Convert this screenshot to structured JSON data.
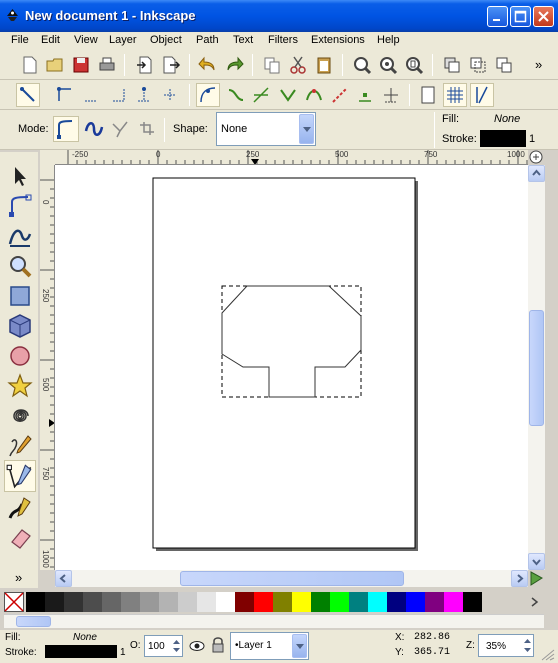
{
  "window": {
    "title": "New document 1 - Inkscape"
  },
  "menu": [
    "File",
    "Edit",
    "View",
    "Layer",
    "Object",
    "Path",
    "Text",
    "Filters",
    "Extensions",
    "Help"
  ],
  "commands_toolbar": {
    "icons": [
      "new-document-icon",
      "open-icon",
      "save-icon",
      "print-icon",
      "import-icon",
      "export-icon",
      "undo-icon",
      "redo-icon",
      "copy-icon",
      "cut-icon",
      "paste-icon",
      "zoom-selection-icon",
      "zoom-drawing-icon",
      "zoom-page-icon",
      "duplicate-icon",
      "clone-icon",
      "unlink-clone-icon"
    ],
    "overflow": "»"
  },
  "snap_toolbar": {
    "icons": [
      "snap-enable-icon",
      "snap-bbox-icon",
      "snap-bbox-edges-icon",
      "snap-bbox-corners-icon",
      "snap-bbox-midpoints-icon",
      "snap-bbox-center-icon",
      "snap-nodes-icon",
      "snap-paths-icon",
      "snap-intersections-icon",
      "snap-cusp-nodes-icon",
      "snap-smooth-nodes-icon",
      "snap-midpoints-icon",
      "snap-centers-icon",
      "snap-rotation-center-icon",
      "snap-page-border-icon",
      "snap-grid-icon",
      "snap-guide-icon"
    ]
  },
  "tool_controls": {
    "mode_label": "Mode:",
    "shape_label": "Shape:",
    "shape_value": "None",
    "fill_label": "Fill:",
    "fill_value": "None",
    "stroke_label": "Stroke:",
    "stroke_width": "1"
  },
  "rulers": {
    "h": [
      "-250",
      "0",
      "250",
      "500",
      "750",
      "1000"
    ],
    "v": [
      "0",
      "250",
      "500",
      "750",
      "1000"
    ]
  },
  "tools": [
    "selector-tool-icon",
    "node-tool-icon",
    "tweak-tool-icon",
    "zoom-tool-icon",
    "rectangle-tool-icon",
    "3d-box-tool-icon",
    "ellipse-tool-icon",
    "star-tool-icon",
    "spiral-tool-icon",
    "pencil-tool-icon",
    "pen-tool-icon",
    "calligraphy-tool-icon",
    "eraser-tool-icon"
  ],
  "active_tool": "pen-tool-icon",
  "palette": [
    "#000000",
    "#1a1a1a",
    "#333333",
    "#4d4d4d",
    "#666666",
    "#808080",
    "#999999",
    "#b3b3b3",
    "#cccccc",
    "#e6e6e6",
    "#ffffff",
    "#800000",
    "#ff0000",
    "#808000",
    "#ffff00",
    "#008000",
    "#00ff00",
    "#008080",
    "#00ffff",
    "#000080",
    "#0000ff",
    "#800080",
    "#ff00ff",
    "#000000"
  ],
  "status": {
    "fill_label": "Fill:",
    "fill_value": "None",
    "stroke_label": "Stroke:",
    "stroke_width": "1",
    "opacity_label": "O:",
    "opacity_value": "100",
    "layer": "•Layer 1",
    "x_label": "X:",
    "x_value": "282.86",
    "y_label": "Y:",
    "y_value": "365.71",
    "zoom_label": "Z:",
    "zoom_value": "35%"
  },
  "colors": {
    "titlebar": "#0054e3",
    "chrome": "#ece9d8",
    "active_tool_bg": "#fffbe8"
  }
}
